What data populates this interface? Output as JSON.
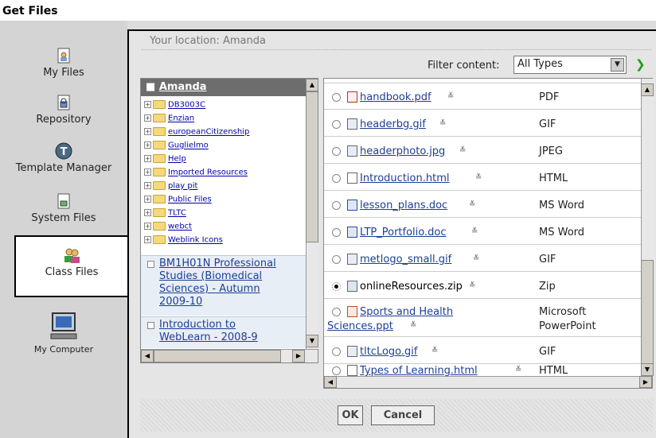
{
  "window": {
    "title": "Get Files"
  },
  "sidebar": {
    "items": [
      {
        "label": "My Files",
        "icon": "my-files-icon"
      },
      {
        "label": "Repository",
        "icon": "repository-icon"
      },
      {
        "label": "Template Manager",
        "icon": "template-manager-icon"
      },
      {
        "label": "System Files",
        "icon": "system-files-icon"
      },
      {
        "label": "Class Files",
        "icon": "class-files-icon",
        "active": true
      },
      {
        "label": "My Computer",
        "icon": "my-computer-icon"
      }
    ]
  },
  "location": {
    "text": "Your location: Amanda"
  },
  "filter": {
    "label": "Filter content:",
    "value": "All Types"
  },
  "tree": {
    "root": "Amanda",
    "folders": [
      "DB3003C",
      "Enzian",
      "europeanCitizenship",
      "Guglielmo",
      "Help",
      "Imported Resources",
      "play pit",
      "Public Files",
      "TLTC",
      "webct",
      "Weblink Icons"
    ],
    "courses": [
      {
        "line1": "BM1H01N Professional",
        "line2": "Studies (Biomedical",
        "line3": "Sciences) - Autumn",
        "line4": "2009-10"
      },
      {
        "line1": "Introduction to",
        "line2": "WebLearn - 2008-9"
      }
    ]
  },
  "files": {
    "rows": [
      {
        "name": "handbook.pdf",
        "type": "PDF",
        "kind": "pdf",
        "selected": false
      },
      {
        "name": "headerbg.gif",
        "type": "GIF",
        "kind": "image",
        "selected": false
      },
      {
        "name": "headerphoto.jpg",
        "type": "JPEG",
        "kind": "image",
        "selected": false
      },
      {
        "name": "Introduction.html",
        "type": "HTML",
        "kind": "html",
        "selected": false
      },
      {
        "name": "lesson_plans.doc",
        "type": "MS Word",
        "kind": "word",
        "selected": false
      },
      {
        "name": "LTP_Portfolio.doc",
        "type": "MS Word",
        "kind": "word",
        "selected": false
      },
      {
        "name": "metlogo_small.gif",
        "type": "GIF",
        "kind": "image",
        "selected": false
      },
      {
        "name": "onlineResources.zip",
        "type": "Zip",
        "kind": "zip",
        "selected": true
      },
      {
        "name_line1": "Sports and Health",
        "name_line2": "Sciences.ppt",
        "type_line1": "Microsoft",
        "type_line2": "PowerPoint",
        "kind": "ppt",
        "selected": false
      },
      {
        "name": "tltcLogo.gif",
        "type": "GIF",
        "kind": "image",
        "selected": false
      },
      {
        "name": "Types of Learning.html",
        "type": "HTML",
        "kind": "html",
        "selected": false
      }
    ]
  },
  "buttons": {
    "ok": "OK",
    "cancel": "Cancel"
  }
}
